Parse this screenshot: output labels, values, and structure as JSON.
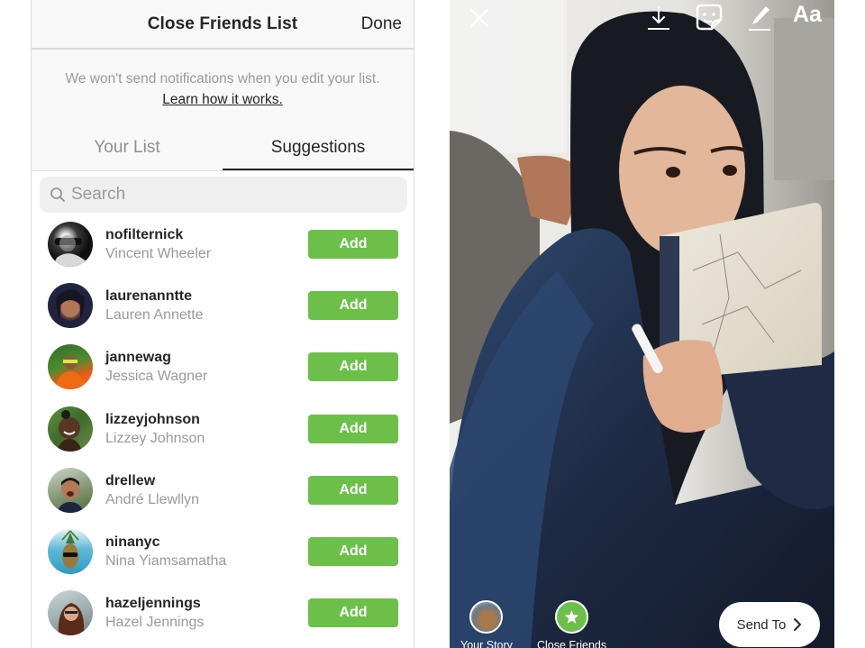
{
  "header": {
    "title": "Close Friends List",
    "done_label": "Done"
  },
  "notice": {
    "message": "We won't send notifications when you edit your list.",
    "link_label": "Learn how it works."
  },
  "tabs": [
    {
      "label": "Your List",
      "active": false
    },
    {
      "label": "Suggestions",
      "active": true
    }
  ],
  "search": {
    "placeholder": "Search",
    "value": "",
    "icon": "search-icon"
  },
  "suggestions": [
    {
      "username": "nofilternick",
      "full_name": "Vincent Wheeler",
      "action_label": "Add"
    },
    {
      "username": "laurenanntte",
      "full_name": "Lauren Annette",
      "action_label": "Add"
    },
    {
      "username": "jannewag",
      "full_name": "Jessica Wagner",
      "action_label": "Add"
    },
    {
      "username": "lizzeyjohnson",
      "full_name": "Lizzey Johnson",
      "action_label": "Add"
    },
    {
      "username": "drellew",
      "full_name": "André Llewllyn",
      "action_label": "Add"
    },
    {
      "username": "ninanyc",
      "full_name": "Nina Yiamsamatha",
      "action_label": "Add"
    },
    {
      "username": "hazeljennings",
      "full_name": "Hazel Jennings",
      "action_label": "Add"
    }
  ],
  "story_camera": {
    "top_tools": [
      {
        "name": "close",
        "icon": "close-icon"
      },
      {
        "name": "download",
        "icon": "download-icon"
      },
      {
        "name": "sticker",
        "icon": "sticker-icon"
      },
      {
        "name": "draw",
        "icon": "pen-icon"
      },
      {
        "name": "text",
        "icon": "text-icon",
        "label": "Aa"
      }
    ],
    "destinations": [
      {
        "label": "Your Story",
        "icon": "avatar"
      },
      {
        "label": "Close Friends",
        "icon": "star-icon"
      }
    ],
    "send_to_label": "Send To",
    "send_to_icon": "chevron-right-icon"
  },
  "colors": {
    "add_button": "#6cc04a",
    "close_friends_badge": "#6cc04a",
    "text_primary": "#262626",
    "text_secondary": "#9a9a9a"
  }
}
